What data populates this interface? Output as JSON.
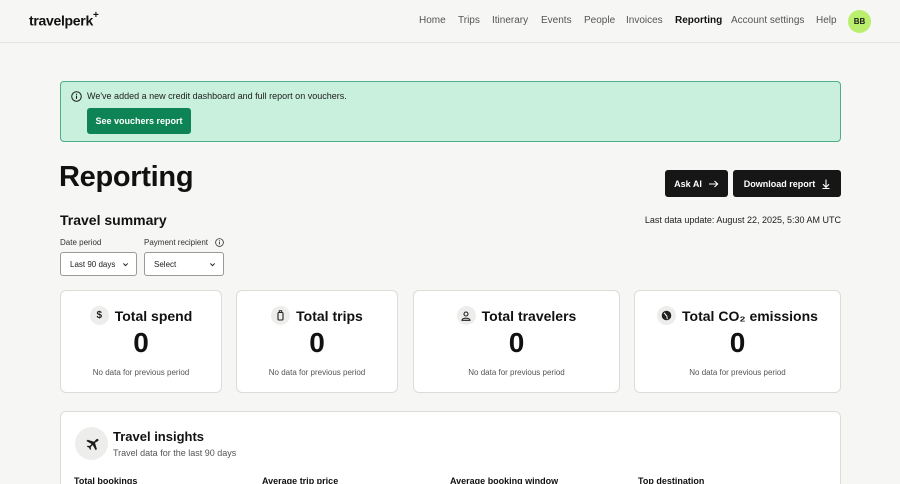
{
  "brand": {
    "name": "travelperk",
    "mark": "+"
  },
  "nav": {
    "items": [
      {
        "label": "Home"
      },
      {
        "label": "Trips"
      },
      {
        "label": "Itinerary"
      },
      {
        "label": "Events"
      },
      {
        "label": "People"
      },
      {
        "label": "Invoices"
      },
      {
        "label": "Reporting",
        "active": true
      },
      {
        "label": "Account settings"
      },
      {
        "label": "Help"
      }
    ],
    "avatar_initials": "BB"
  },
  "banner": {
    "icon": "info-circle-icon",
    "text": "We've added a new credit dashboard and full report on vouchers.",
    "button_label": "See vouchers report"
  },
  "header": {
    "title": "Reporting",
    "ask_ai_label": "Ask AI",
    "download_label": "Download report"
  },
  "summary": {
    "title": "Travel summary",
    "last_update": "Last data update: August 22, 2025, 5:30 AM UTC",
    "date_period": {
      "label": "Date period",
      "value": "Last 90 days"
    },
    "payment_recipient": {
      "label": "Payment recipient",
      "value": "Select"
    }
  },
  "cards": [
    {
      "title": "Total spend",
      "icon": "dollar-icon",
      "value": "0",
      "sub": "No data for previous period"
    },
    {
      "title": "Total trips",
      "icon": "luggage-icon",
      "value": "0",
      "sub": "No data for previous period"
    },
    {
      "title": "Total travelers",
      "icon": "person-icon",
      "value": "0",
      "sub": "No data for previous period"
    },
    {
      "title": "Total CO₂ emissions",
      "icon": "globe-icon",
      "value": "0",
      "sub": "No data for previous period"
    }
  ],
  "insights": {
    "title": "Travel insights",
    "subtitle": "Travel data for the last 90 days",
    "metrics": [
      {
        "label": "Total bookings"
      },
      {
        "label": "Average trip price"
      },
      {
        "label": "Average booking window"
      },
      {
        "label": "Top destination"
      }
    ]
  },
  "colors": {
    "accent_green": "#0e8455",
    "banner_bg": "#c8f0dd",
    "avatar": "#b9ef6c",
    "dark_button": "#161616"
  }
}
